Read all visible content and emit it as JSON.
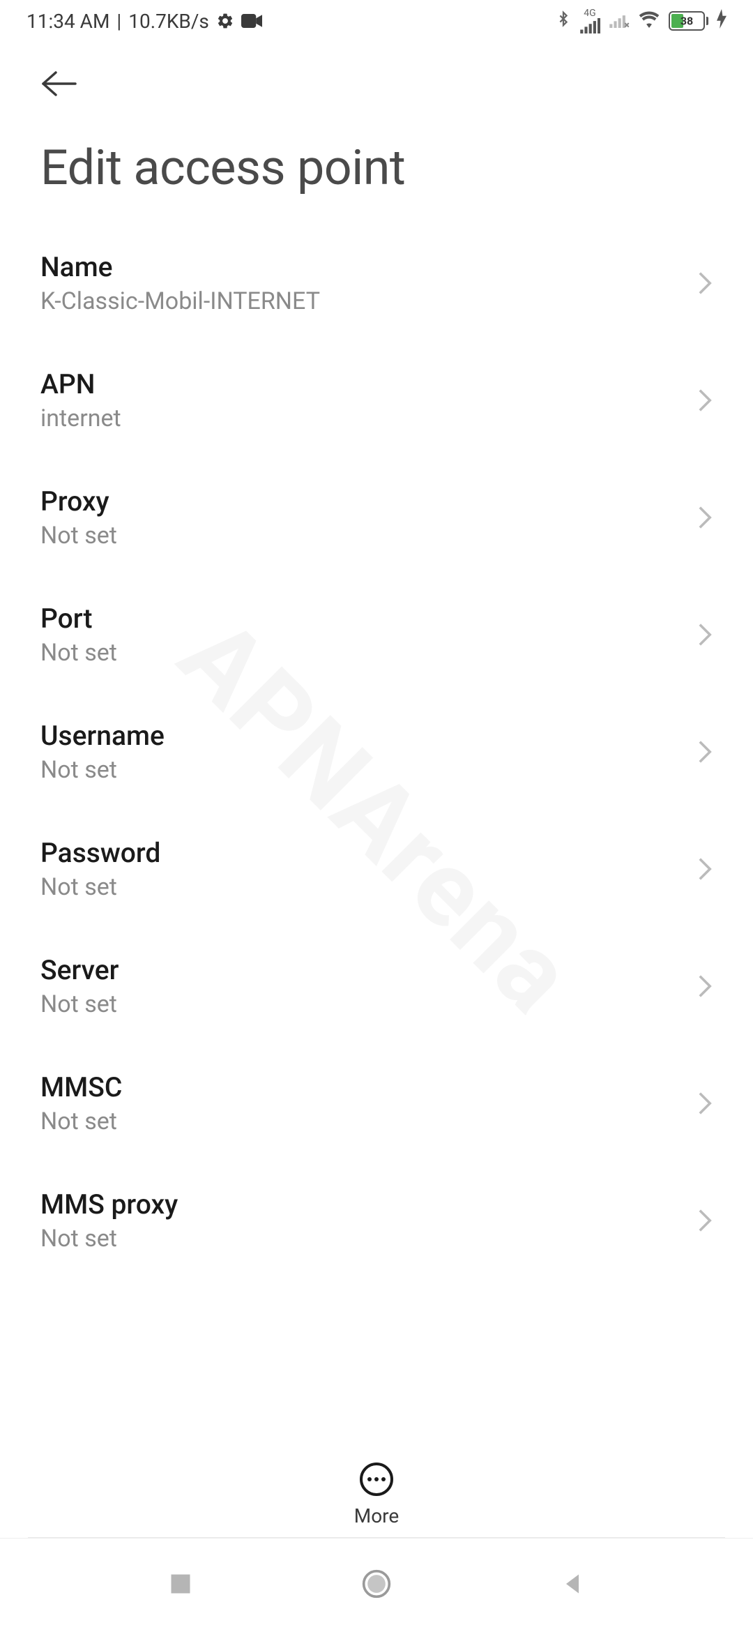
{
  "status_bar": {
    "time": "11:34 AM",
    "separator": "|",
    "data_rate": "10.7KB/s",
    "battery_pct": "38",
    "network_label": "4G"
  },
  "header": {
    "title": "Edit access point"
  },
  "settings": [
    {
      "label": "Name",
      "value": "K-Classic-Mobil-INTERNET"
    },
    {
      "label": "APN",
      "value": "internet"
    },
    {
      "label": "Proxy",
      "value": "Not set"
    },
    {
      "label": "Port",
      "value": "Not set"
    },
    {
      "label": "Username",
      "value": "Not set"
    },
    {
      "label": "Password",
      "value": "Not set"
    },
    {
      "label": "Server",
      "value": "Not set"
    },
    {
      "label": "MMSC",
      "value": "Not set"
    },
    {
      "label": "MMS proxy",
      "value": "Not set"
    }
  ],
  "bottom_action": {
    "label": "More"
  },
  "watermark": "APNArena"
}
